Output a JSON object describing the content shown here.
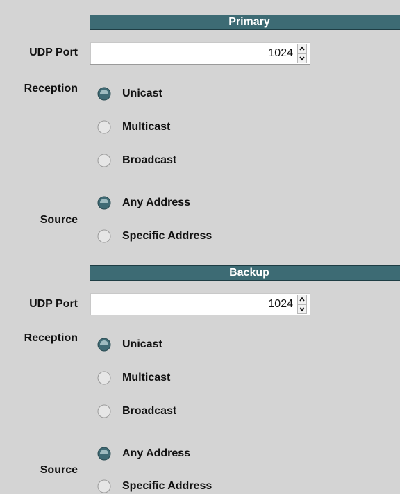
{
  "primary": {
    "header": "Primary",
    "udp_port_label": "UDP Port",
    "udp_port_value": "1024",
    "reception_label": "Reception",
    "reception_options": [
      {
        "label": "Unicast",
        "selected": true
      },
      {
        "label": "Multicast",
        "selected": false
      },
      {
        "label": "Broadcast",
        "selected": false
      }
    ],
    "source_label": "Source",
    "source_options": [
      {
        "label": "Any Address",
        "selected": true
      },
      {
        "label": "Specific Address",
        "selected": false
      }
    ]
  },
  "backup": {
    "header": "Backup",
    "udp_port_label": "UDP Port",
    "udp_port_value": "1024",
    "reception_label": "Reception",
    "reception_options": [
      {
        "label": "Unicast",
        "selected": true
      },
      {
        "label": "Multicast",
        "selected": false
      },
      {
        "label": "Broadcast",
        "selected": false
      }
    ],
    "source_label": "Source",
    "source_options": [
      {
        "label": "Any Address",
        "selected": true
      },
      {
        "label": "Specific Address",
        "selected": false
      }
    ]
  },
  "colors": {
    "background": "#d4d4d4",
    "header_bg": "#3d6b74",
    "header_text": "#ffffff",
    "radio_selected": "#3f6a74"
  }
}
